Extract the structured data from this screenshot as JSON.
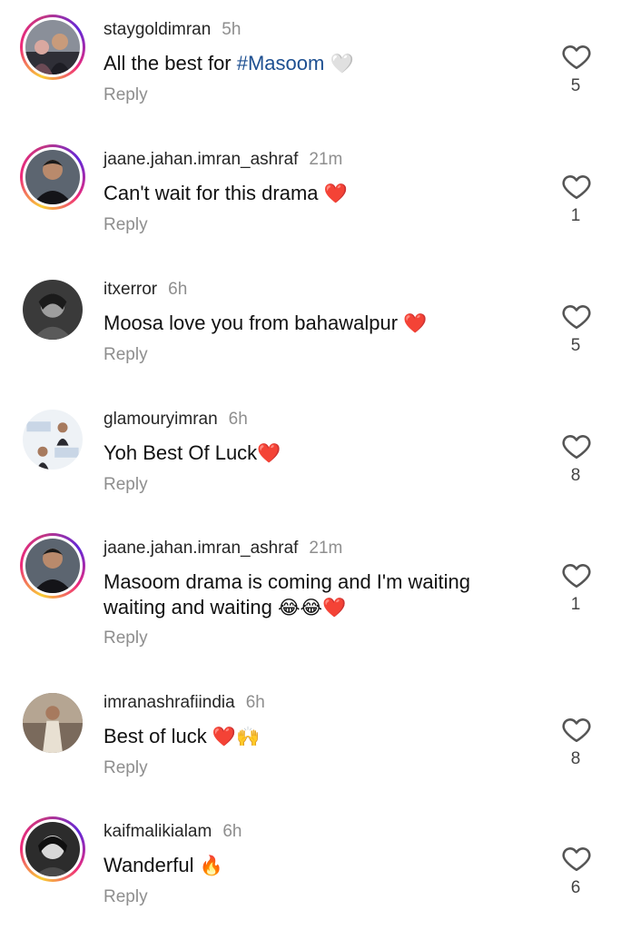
{
  "comments": [
    {
      "username": "staygoldimran",
      "time": "5h",
      "text": "All the best for ",
      "hashtag": "#Masoom",
      "emoji": "🤍",
      "reply": "Reply",
      "likes": "5"
    },
    {
      "username": "jaane.jahan.imran_ashraf",
      "time": "21m",
      "text": "Can't wait for this drama ",
      "emoji": "❤️",
      "reply": "Reply",
      "likes": "1"
    },
    {
      "username": "itxerror",
      "time": "6h",
      "text": "Moosa love you from bahawalpur ",
      "emoji": "❤️",
      "reply": "Reply",
      "likes": "5"
    },
    {
      "username": "glamouryimran",
      "time": "6h",
      "text": "Yoh Best Of Luck",
      "emoji": "❤️",
      "reply": "Reply",
      "likes": "8"
    },
    {
      "username": "jaane.jahan.imran_ashraf",
      "time": "21m",
      "text": "Masoom drama is coming and I'm waiting waiting and waiting ",
      "emoji": "😂😂❤️",
      "reply": "Reply",
      "likes": "1"
    },
    {
      "username": "imranashrafiindia",
      "time": "6h",
      "text": "Best of luck ",
      "emoji": "❤️🙌",
      "reply": "Reply",
      "likes": "8"
    },
    {
      "username": "kaifmalikialam",
      "time": "6h",
      "text": "Wanderful ",
      "emoji": "🔥",
      "reply": "Reply",
      "likes": "6"
    }
  ],
  "icons": {
    "avatar": "avatar-image",
    "like": "heart-outline-icon"
  },
  "colors": {
    "hashtag": "#1d4f91",
    "meta": "#8e8e8e",
    "story_ring": "#ee2a7b"
  }
}
